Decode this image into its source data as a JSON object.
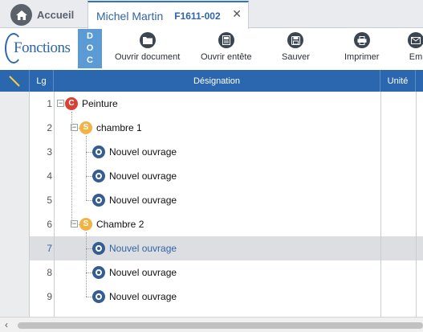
{
  "tabs": {
    "home_label": "Accueil",
    "active_name": "Michel Martin",
    "active_code": "F1611-002",
    "close_glyph": "✕"
  },
  "toolbar": {
    "logo_text": "Fonctions",
    "doc_letters": [
      "D",
      "O",
      "C"
    ],
    "buttons": [
      {
        "label": "Ouvrir document",
        "icon": "folder-icon"
      },
      {
        "label": "Ouvrir entête",
        "icon": "document-header-icon"
      },
      {
        "label": "Sauver",
        "icon": "save-icon"
      },
      {
        "label": "Imprimer",
        "icon": "printer-icon"
      },
      {
        "label": "Em",
        "icon": "email-icon"
      }
    ]
  },
  "grid": {
    "columns": {
      "lg": "Lg",
      "designation": "Désignation",
      "unite": "Unité"
    },
    "rows": [
      {
        "lg": "1",
        "type": "C",
        "label": "Peinture",
        "level": 0,
        "expander": "−",
        "selected": false
      },
      {
        "lg": "2",
        "type": "S",
        "label": "chambre 1",
        "level": 1,
        "expander": "−",
        "selected": false
      },
      {
        "lg": "3",
        "type": "O",
        "label": "Nouvel ouvrage",
        "level": 2,
        "expander": "",
        "selected": false
      },
      {
        "lg": "4",
        "type": "O",
        "label": "Nouvel ouvrage",
        "level": 2,
        "expander": "",
        "selected": false
      },
      {
        "lg": "5",
        "type": "O",
        "label": "Nouvel ouvrage",
        "level": 2,
        "expander": "",
        "selected": false
      },
      {
        "lg": "6",
        "type": "S",
        "label": "Chambre 2",
        "level": 1,
        "expander": "−",
        "selected": false
      },
      {
        "lg": "7",
        "type": "O",
        "label": "Nouvel ouvrage",
        "level": 2,
        "expander": "",
        "selected": true
      },
      {
        "lg": "8",
        "type": "O",
        "label": "Nouvel ouvrage",
        "level": 2,
        "expander": "",
        "selected": false
      },
      {
        "lg": "9",
        "type": "O",
        "label": "Nouvel ouvrage",
        "level": 2,
        "expander": "",
        "selected": false
      }
    ]
  },
  "colors": {
    "header_blue": "#2a67ae",
    "accent_blue": "#2f65a8",
    "type_c": "#d84235",
    "type_s": "#f2b344",
    "type_o": "#365d92"
  },
  "scrollbar": {
    "left_arrow": "‹"
  }
}
